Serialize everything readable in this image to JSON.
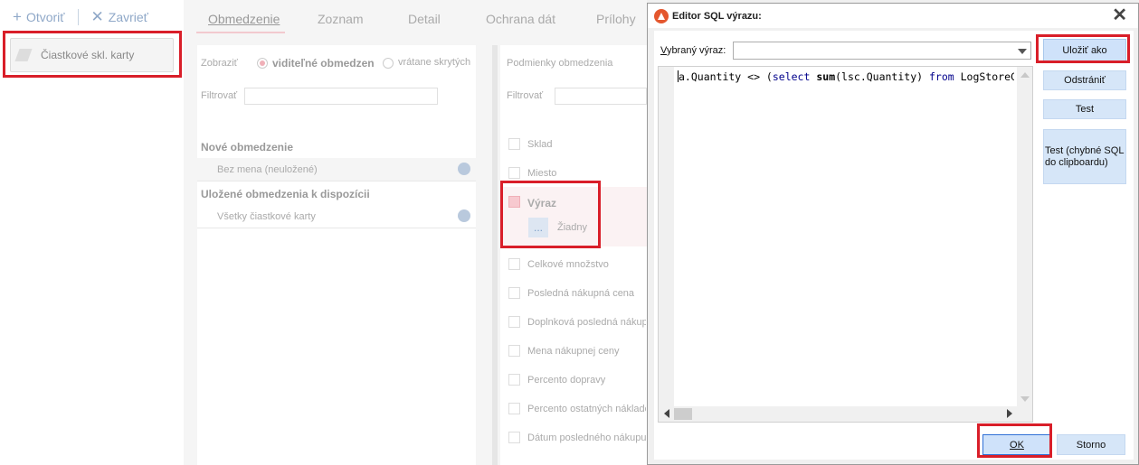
{
  "left": {
    "toolbar": {
      "open_label": "Otvoriť",
      "close_label": "Zavrieť"
    },
    "card_item_label": "Čiastkové skl. karty"
  },
  "tabs": [
    "Obmedzenie",
    "Zoznam",
    "Detail",
    "Ochrana dát",
    "Prílohy"
  ],
  "restrictions": {
    "show_label": "Zobraziť",
    "show_options": [
      "viditeľné obmedzen",
      "vrátane skrytých"
    ],
    "filter_label": "Filtrovať",
    "new_header": "Nové obmedzenie",
    "new_item": "Bez mena (neuložené)",
    "saved_header": "Uložené obmedzenia k dispozícii",
    "saved_item": "Všetky čiastkové karty"
  },
  "conditions": {
    "title": "Podmienky obmedzenia",
    "filter_label": "Filtrovať",
    "items": [
      "Sklad",
      "Miesto"
    ],
    "expression": {
      "label": "Výraz",
      "value": "Žiadny",
      "dots": "..."
    },
    "more_items": [
      "Celkové množstvo",
      "Posledná nákupná cena",
      "Doplnková posledná nákupn",
      "Mena nákupnej ceny",
      "Percento dopravy",
      "Percento ostatných náklado",
      "Dátum posledného nákupu"
    ]
  },
  "dialog": {
    "title": "Editor SQL výrazu:",
    "selected_label": "Vybraný výraz:",
    "selected_value": "",
    "code": {
      "p1": "a.Quantity <> (",
      "kw1": "select",
      "p2": " ",
      "fn1": "sum",
      "p3": "(lsc.Quantity) ",
      "kw2": "from",
      "p4": " LogStoreC"
    },
    "buttons": {
      "save_as": "Uložiť ako",
      "remove": "Odstrániť",
      "test": "Test",
      "test_bad": "Test (chybné SQL do clipboardu)",
      "ok": "OK",
      "cancel": "Storno"
    }
  },
  "colors": {
    "highlight": "#d91e29",
    "accent_button": "#cfe2fa",
    "keyword": "#00008b"
  }
}
